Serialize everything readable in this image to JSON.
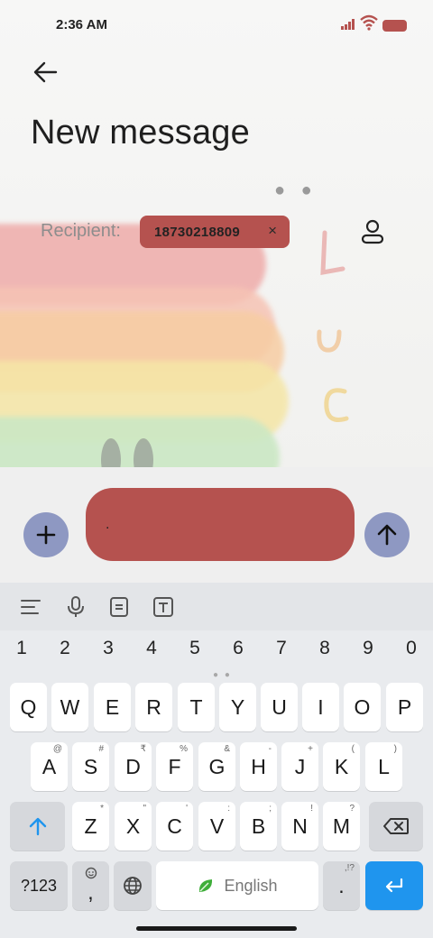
{
  "status_bar": {
    "time": "2:36 AM"
  },
  "header": {
    "title": "New message"
  },
  "recipient": {
    "label": "Recipient:",
    "chip_number": "18730218809",
    "chip_close": "×"
  },
  "compose": {
    "message_value": "."
  },
  "keyboard": {
    "number_row": [
      "1",
      "2",
      "3",
      "4",
      "5",
      "6",
      "7",
      "8",
      "9",
      "0"
    ],
    "row1": [
      "Q",
      "W",
      "E",
      "R",
      "T",
      "Y",
      "U",
      "I",
      "O",
      "P"
    ],
    "row2": [
      {
        "key": "A",
        "hint": "@"
      },
      {
        "key": "S",
        "hint": "#"
      },
      {
        "key": "D",
        "hint": "₹"
      },
      {
        "key": "F",
        "hint": "%"
      },
      {
        "key": "G",
        "hint": "&"
      },
      {
        "key": "H",
        "hint": "-"
      },
      {
        "key": "J",
        "hint": "+"
      },
      {
        "key": "K",
        "hint": "("
      },
      {
        "key": "L",
        "hint": ")"
      }
    ],
    "row3": [
      {
        "key": "Z",
        "hint": "*"
      },
      {
        "key": "X",
        "hint": "\""
      },
      {
        "key": "C",
        "hint": "'"
      },
      {
        "key": "V",
        "hint": ":"
      },
      {
        "key": "B",
        "hint": ";"
      },
      {
        "key": "N",
        "hint": "!"
      },
      {
        "key": "M",
        "hint": "?"
      }
    ],
    "symbols_label": "?123",
    "comma_label": ",",
    "space_label": "English",
    "period_label": ".",
    "period_hint": ",!?"
  },
  "colors": {
    "redacted": "#b5524f",
    "accent_blue": "#1f95ee",
    "round_button": "#8e98c2"
  },
  "icons": [
    "back-arrow-icon",
    "contact-icon",
    "plus-icon",
    "send-arrow-icon",
    "text-format-icon",
    "microphone-icon",
    "clipboard-icon",
    "text-box-icon",
    "shift-icon",
    "backspace-icon",
    "emoji-icon",
    "globe-icon",
    "leaf-icon",
    "enter-icon",
    "wifi-icon",
    "signal-icon",
    "battery-icon"
  ]
}
